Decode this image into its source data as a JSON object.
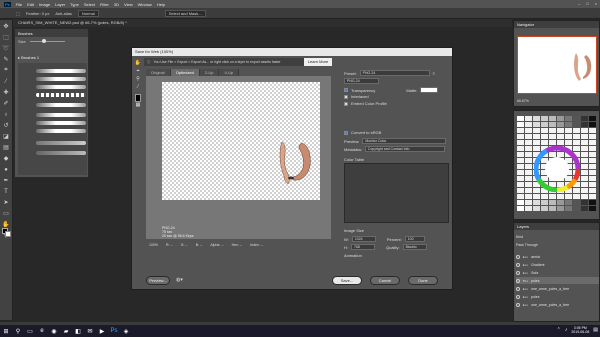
{
  "menu": [
    "File",
    "Edit",
    "Image",
    "Layer",
    "Type",
    "Select",
    "Filter",
    "3D",
    "View",
    "Window",
    "Help"
  ],
  "options": {
    "feather": "Feather: 0 px",
    "antialias": "Anti-alias",
    "style": "Normal",
    "select_mask": "Select and Mask..."
  },
  "doc_tab": {
    "title": "CHAIRS_SIM_WHITE_NEW2.psd @ 66.7% (poles, RGB/8) *"
  },
  "brushes": {
    "title": "Brushes",
    "size_label": "Size",
    "folder": "Brushes 1"
  },
  "dialog": {
    "title": "Save for Web (100%)",
    "info_text": "You Use File > Export > Export As... or right click on a layer to export assets faster",
    "learn_more": "Learn More",
    "tabs": [
      "Original",
      "Optimized",
      "2-Up",
      "4-Up"
    ],
    "active_tab": "Optimized",
    "preview_info": [
      "PNG-24",
      "75 sec",
      "20 sec @ 56.6 Kbps"
    ],
    "footer": [
      "100%",
      "R: --",
      "G: --",
      "B: --",
      "Alpha: --",
      "Hex: --",
      "Index: --"
    ],
    "preset_label": "Preset:",
    "preset_value": "PNG-24",
    "format_value": "PNG-24",
    "transparency": "Transparency",
    "interlaced": "Interlaced",
    "embed_profile": "Embed Color Profile",
    "matte_label": "Matte:",
    "convert_srgb": "Convert to sRGB",
    "preview_label": "Preview:",
    "preview_value": "Monitor Color",
    "metadata_label": "Metadata:",
    "metadata_value": "Copyright and Contact Info",
    "color_table": "Color Table",
    "image_size": "Image Size",
    "w_label": "W:",
    "w_value": "1024",
    "h_label": "H:",
    "h_value": "768",
    "percent_label": "Percent:",
    "percent_value": "100",
    "quality_label": "Quality:",
    "quality_value": "Bicubic",
    "animation": "Animation",
    "preview_btn": "Preview...",
    "save_btn": "Save...",
    "cancel_btn": "Cancel",
    "done_btn": "Done"
  },
  "navigator": {
    "title": "Navigator",
    "zoom": "66.67%"
  },
  "layers": {
    "title": "Layers",
    "kind": "Kind",
    "blend": "Pass Through",
    "rows": [
      "armia",
      "Gradient",
      "Sofa",
      "poles",
      "one_arme_poles_a_free",
      "poles",
      "one_arme_poles_a_free"
    ]
  },
  "taskbar": {
    "time": "3:05 PM",
    "date": "2019-06-08"
  }
}
